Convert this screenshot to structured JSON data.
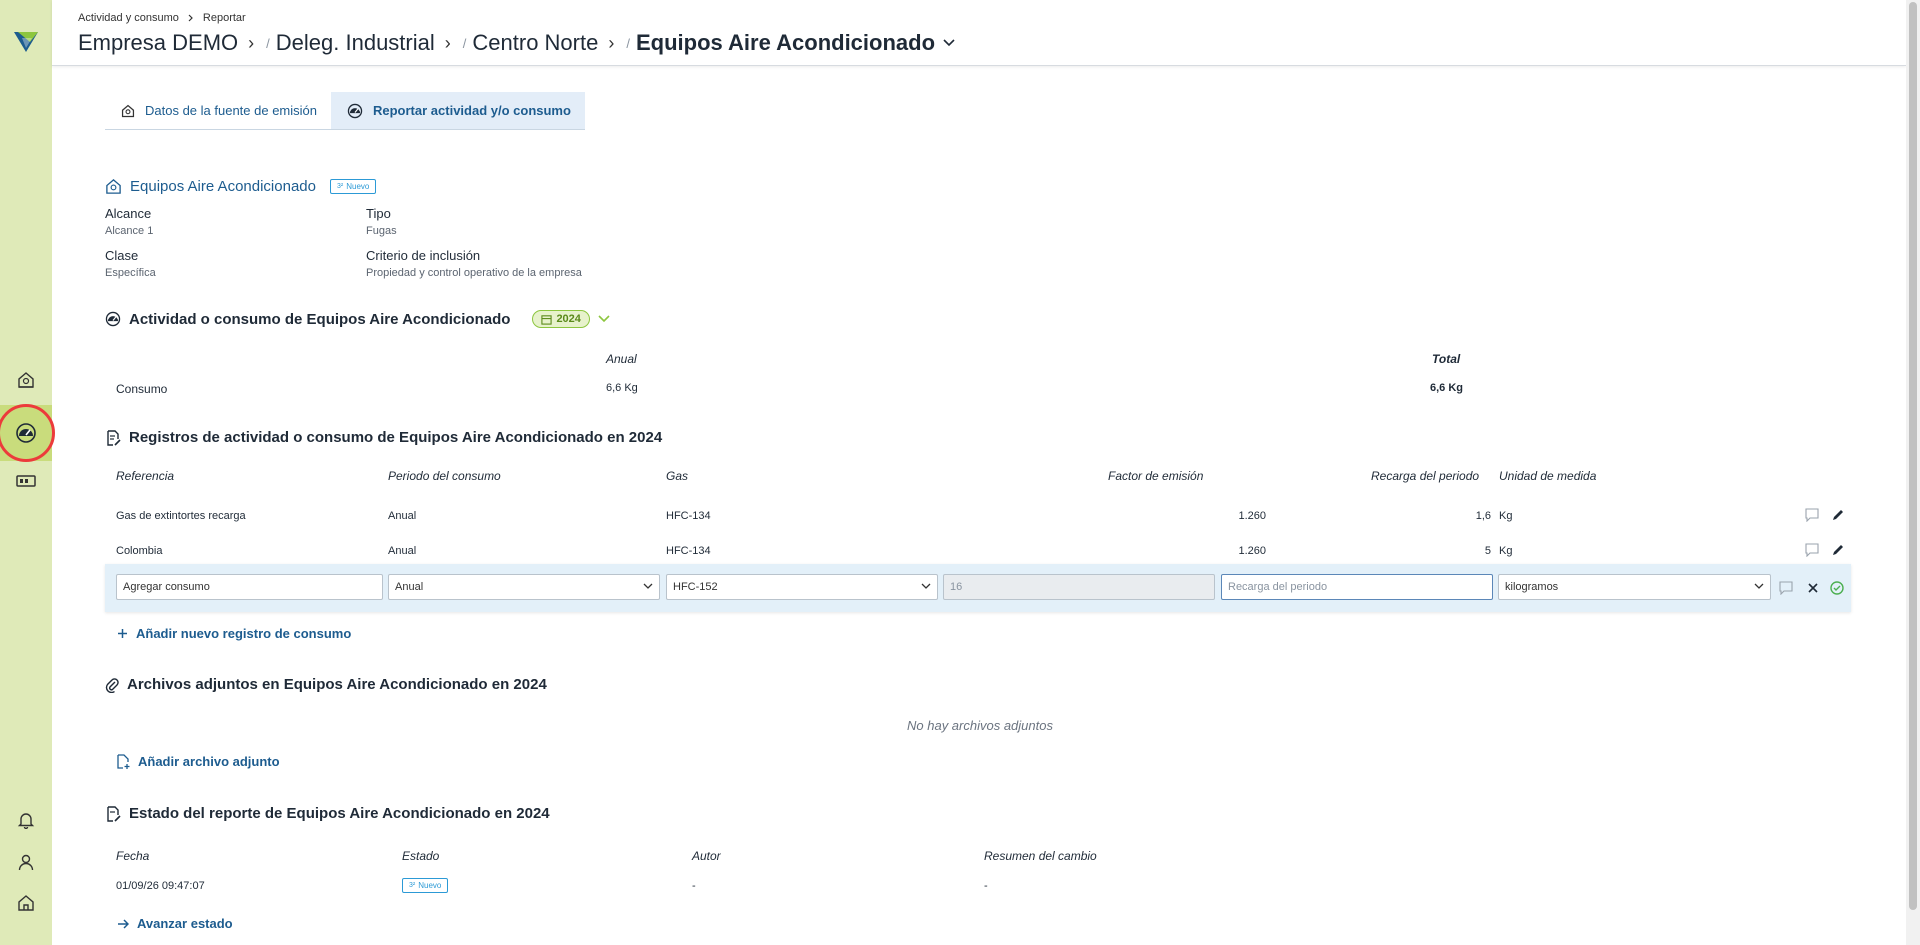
{
  "breadcrumb": {
    "root": "Actividad y consumo",
    "current": "Reportar"
  },
  "path": [
    "Empresa DEMO",
    "Deleg. Industrial",
    "Centro Norte"
  ],
  "path_current": "Equipos Aire Acondicionado",
  "tabs": [
    {
      "label": "Datos de la fuente de emisión"
    },
    {
      "label": "Reportar actividad y/o consumo"
    }
  ],
  "source": {
    "name": "Equipos Aire Acondicionado",
    "badge": "Nuevo",
    "fields": [
      {
        "label": "Alcance",
        "value": "Alcance 1"
      },
      {
        "label": "Tipo",
        "value": "Fugas"
      },
      {
        "label": "Clase",
        "value": "Específica"
      },
      {
        "label": "Criterio de inclusión",
        "value": "Propiedad y control operativo de la empresa"
      }
    ]
  },
  "activity": {
    "title": "Actividad o consumo de Equipos Aire Acondicionado",
    "year": "2024",
    "headers": {
      "annual": "Anual",
      "total": "Total"
    },
    "row": {
      "label": "Consumo",
      "annual": "6,6 Kg",
      "total": "6,6 Kg"
    }
  },
  "records": {
    "title": "Registros de actividad o consumo de Equipos Aire Acondicionado en 2024",
    "headers": [
      "Referencia",
      "Periodo del consumo",
      "Gas",
      "Factor de emisión",
      "Recarga del periodo",
      "Unidad de medida"
    ],
    "rows": [
      {
        "ref": "Gas de extintortes recarga",
        "period": "Anual",
        "gas": "HFC-134",
        "factor": "1.260",
        "recharge": "1,6",
        "unit": "Kg"
      },
      {
        "ref": "Colombia",
        "period": "Anual",
        "gas": "HFC-134",
        "factor": "1.260",
        "recharge": "5",
        "unit": "Kg"
      }
    ],
    "edit": {
      "ref_value": "Agregar consumo",
      "period_value": "Anual",
      "gas_value": "HFC-152",
      "factor_value": "16",
      "recharge_placeholder": "Recarga del periodo",
      "unit_value": "kilogramos"
    },
    "add_label": "Añadir nuevo registro de consumo"
  },
  "attachments": {
    "title": "Archivos adjuntos en Equipos Aire Acondicionado en 2024",
    "empty": "No hay archivos adjuntos",
    "add_label": "Añadir archivo adjunto"
  },
  "status": {
    "title": "Estado del reporte de Equipos Aire Acondicionado en 2024",
    "headers": [
      "Fecha",
      "Estado",
      "Autor",
      "Resumen del cambio"
    ],
    "row": {
      "date": "01/09/26 09:47:07",
      "state": "Nuevo",
      "author": "-",
      "summary": "-"
    },
    "advance_label": "Avanzar estado"
  },
  "colors": {
    "sidebar": "#dfeab8",
    "link": "#1d5c8f",
    "accent_green": "#8dc63f",
    "badge_blue": "#2c9ad6",
    "highlight_circle": "#ec3b3b"
  }
}
